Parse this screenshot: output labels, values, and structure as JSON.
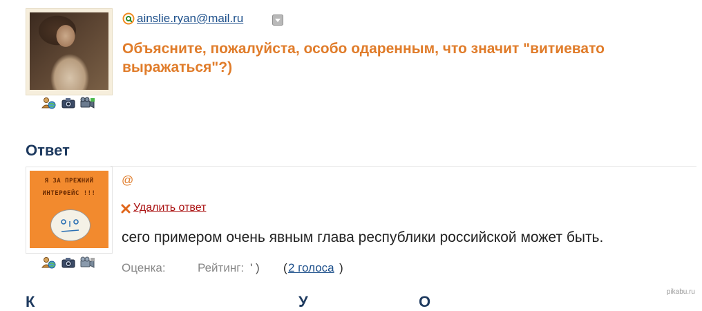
{
  "question": {
    "author_email": "ainslie.ryan@mail.ru",
    "title": "Объясните, пожалуйста, особо одаренным, что значит \"витиевато выражаться\"?)"
  },
  "answer_section": {
    "heading": "Ответ",
    "author_symbol": "@",
    "delete_label": "Удалить ответ",
    "text": "сего примером очень явным глава республики российской может быть.",
    "rating_label": "Оценка:",
    "rank_label": "Рейтинг:",
    "rank_value": "' )",
    "votes_label": "2 голоса",
    "votes_open": "(",
    "votes_close": ")"
  },
  "avatar_text": {
    "line1": "Я ЗА ПРЕЖНИЙ",
    "line2": "ИНТЕРФЕЙС !!!"
  },
  "bottom_cut": {
    "a": "К",
    "b": "У",
    "c": "О"
  },
  "watermark": "pikabu.ru",
  "icons": [
    "user-globe-icon",
    "camera-icon",
    "video-camera-icon",
    "mail-at-icon",
    "dropdown-arrow-icon",
    "delete-x-icon"
  ],
  "colors": {
    "link": "#1b4e8a",
    "question": "#e07c2a",
    "heading": "#1e3a5f",
    "delete": "#aa1111",
    "muted": "#888888",
    "avatar_orange": "#f28a2e"
  }
}
